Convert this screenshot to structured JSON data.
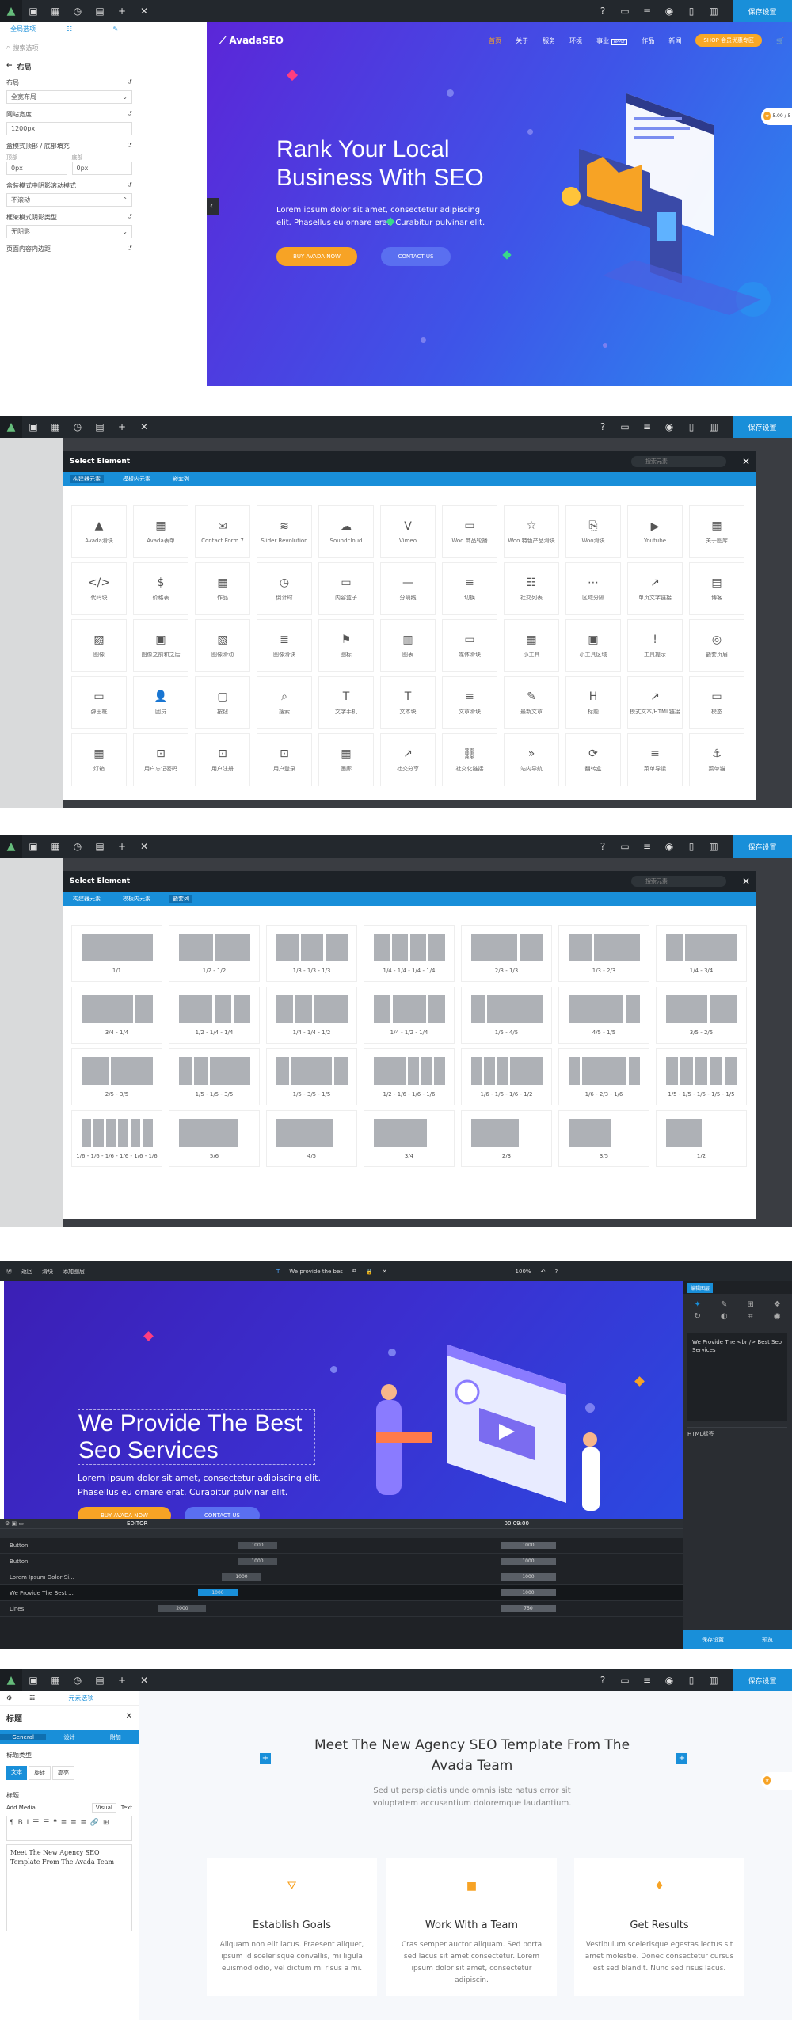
{
  "topbar": {
    "save_label": "保存设置"
  },
  "panel1": {
    "side_tabs": [
      "全局选项",
      "☷",
      "✎"
    ],
    "search_placeholder": "搜索选项",
    "section": "布局",
    "options": [
      {
        "label": "布局",
        "value": "全宽布局"
      },
      {
        "label": "网站宽度",
        "value": "1200px"
      },
      {
        "label": "盒模式顶部 / 底部填充",
        "sub": [
          "顶部",
          "底部"
        ],
        "values": [
          "0px",
          "0px"
        ]
      },
      {
        "label": "盒装模式中阴影滚动模式",
        "value": "不滚动"
      },
      {
        "label": "框架模式阴影类型",
        "value": "无阴影"
      },
      {
        "label": "页面内容内边距",
        "value": ""
      }
    ],
    "hero": {
      "logo": "AvadaSEO",
      "nav": [
        "首页",
        "关于",
        "服务",
        "环境",
        "事业",
        "作品",
        "新闻"
      ],
      "nav_badge": "APPLY",
      "nav_cta": "SHOP 会员优惠专区",
      "title": "Rank Your Local Business With SEO",
      "subtitle": "Lorem ipsum dolor sit amet, consectetur adipiscing elit. Phasellus eu ornare erat. Curabitur pulvinar elit.",
      "btn1": "BUY AVADA NOW",
      "btn2": "CONTACT US",
      "badge": "5.00 / 5"
    }
  },
  "panel2": {
    "modal_title": "Select Element",
    "search_placeholder": "搜索元素",
    "tabs": [
      "构建器元素",
      "模板内元素",
      "嵌套列"
    ],
    "elements": [
      [
        "Avada滑块",
        "Avada表单",
        "Contact Form 7",
        "Slider Revolution",
        "Soundcloud",
        "Vimeo",
        "Woo 商品轮播",
        "Woo 特色产品滑块",
        "Woo滑块",
        "Youtube",
        "关于图库"
      ],
      [
        "代码块",
        "价格表",
        "作品",
        "倒计时",
        "内容盒子",
        "分隔线",
        "切换",
        "社交列表",
        "区域分隔",
        "单页文字链接",
        "博客"
      ],
      [
        "图像",
        "图像之前和之后",
        "图像滑动",
        "图像滑块",
        "图标",
        "图表",
        "媒体滑块",
        "小工具",
        "小工具区域",
        "工具提示",
        "嵌套页眉"
      ],
      [
        "弹出框",
        "团员",
        "按钮",
        "搜索",
        "文字手机",
        "文本块",
        "文章滑块",
        "最新文章",
        "标题",
        "模式文本/HTML链接",
        "模态"
      ],
      [
        "灯箱",
        "用户忘记密码",
        "用户注册",
        "用户登录",
        "画廊",
        "社交分享",
        "社交化链接",
        "站内导航",
        "翻转盒",
        "菜单导读",
        "菜单锚"
      ]
    ]
  },
  "panel3": {
    "modal_title": "Select Element",
    "tabs": [
      "构建器元素",
      "模板内元素",
      "嵌套列"
    ],
    "columns": [
      "1/1",
      "1/2 - 1/2",
      "1/3 - 1/3 - 1/3",
      "1/4 - 1/4 - 1/4 - 1/4",
      "2/3 - 1/3",
      "1/3 - 2/3",
      "1/4 - 3/4",
      "3/4 - 1/4",
      "1/2 - 1/4 - 1/4",
      "1/4 - 1/4 - 1/2",
      "1/4 - 1/2 - 1/4",
      "1/5 - 4/5",
      "4/5 - 1/5",
      "3/5 - 2/5",
      "2/5 - 3/5",
      "1/5 - 1/5 - 3/5",
      "1/5 - 3/5 - 1/5",
      "1/2 - 1/6 - 1/6 - 1/6",
      "1/6 - 1/6 - 1/6 - 1/2",
      "1/6 - 2/3 - 1/6",
      "1/5 - 1/5 - 1/5 - 1/5 - 1/5",
      "1/6 - 1/6 - 1/6 - 1/6 - 1/6 - 1/6",
      "5/6",
      "4/5",
      "3/4",
      "2/3",
      "3/5",
      "1/2"
    ]
  },
  "panel4": {
    "toolbar": [
      "返回",
      "滑块",
      "添加图层"
    ],
    "crumb": "We provide the bes",
    "zoom": "100%",
    "title": "We Provide The Best Seo Services",
    "subtitle": "Lorem ipsum dolor sit amet, consectetur adipiscing elit. Phasellus eu ornare erat. Curabitur pulvinar elit.",
    "btn1": "BUY AVADA NOW",
    "btn2": "CONTACT US",
    "timeline_label": "EDITOR",
    "timecode": "00:09:00",
    "layers": [
      {
        "name": "Button",
        "start": "1000",
        "end": "1000"
      },
      {
        "name": "Button",
        "start": "1000",
        "end": "1000"
      },
      {
        "name": "Lorem Ipsum Dolor Si...",
        "start": "1000",
        "end": "1000"
      },
      {
        "name": "We Provide The Best ...",
        "start": "1000",
        "end": "1000"
      },
      {
        "name": "Lines",
        "start": "2000",
        "end": "750"
      }
    ],
    "right_title": "编辑图层",
    "right_text": "We Provide The <br /> Best Seo Services",
    "right_tag": "HTML标签",
    "save": "保存设置",
    "preview": "预览"
  },
  "panel5": {
    "side_tabs": [
      "General",
      "设计",
      "附加"
    ],
    "element_label": "元素选项",
    "heading": "标题",
    "type_label": "标题类型",
    "type_opts": [
      "文本",
      "旋转",
      "高亮"
    ],
    "editor_label": "标题",
    "add_media": "Add Media",
    "visual": "Visual",
    "text": "Text",
    "editor_content": "Meet The New Agency SEO Template From The Avada Team",
    "main_title": "Meet The New Agency SEO Template From The Avada Team",
    "main_sub": "Sed ut perspiciatis unde omnis iste natus error sit voluptatem accusantium doloremque laudantium.",
    "cards": [
      {
        "title": "Establish Goals",
        "desc": "Aliquam non elit lacus. Praesent aliquet, ipsum id scelerisque convallis, mi ligula euismod odio, vel dictum mi risus a mi."
      },
      {
        "title": "Work With a Team",
        "desc": "Cras semper auctor aliquam. Sed porta sed lacus sit amet consectetur. Lorem ipsum dolor sit amet, consectetur adipiscin."
      },
      {
        "title": "Get Results",
        "desc": "Vestibulum scelerisque egestas lectus sit amet molestie. Donec consectetur cursus est sed blandit. Nunc sed risus lacus."
      }
    ]
  }
}
